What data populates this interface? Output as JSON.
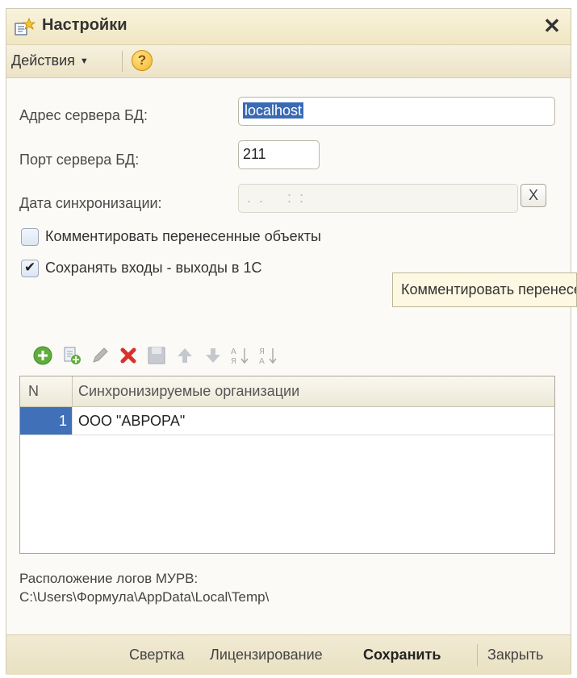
{
  "window": {
    "title": "Настройки"
  },
  "toolbar": {
    "actions_label": "Действия",
    "help_symbol": "?"
  },
  "form": {
    "server_address_label": "Адрес сервера БД:",
    "server_address_value": "localhost",
    "server_port_label": "Порт сервера БД:",
    "server_port_value": "211",
    "sync_date_label": "Дата синхронизации:",
    "sync_date_value": " .  .      :  :",
    "clear_button_label": "X",
    "comment_checkbox_label": "Комментировать перенесенные объекты",
    "comment_checked": false,
    "save_entries_checkbox_label": "Сохранять входы - выходы в 1С",
    "save_entries_checked": true
  },
  "tooltip": {
    "text": "Комментировать перенесенные объекты"
  },
  "table_toolbar": {
    "icons": [
      "add-icon",
      "copy-icon",
      "edit-icon",
      "delete-icon",
      "end-edit-icon",
      "move-up-icon",
      "move-down-icon",
      "sort-asc-icon",
      "sort-desc-icon"
    ]
  },
  "table": {
    "columns": [
      "N",
      "Синхронизируемые организации"
    ],
    "rows": [
      {
        "n": "1",
        "organization": "ООО \"АВРОРА\""
      }
    ]
  },
  "logs": {
    "label": "Расположение логов МУРВ:",
    "path": "C:\\Users\\Формула\\AppData\\Local\\Temp\\"
  },
  "bottom": {
    "fold_label": "Свертка",
    "licensing_label": "Лицензирование",
    "save_label": "Сохранить",
    "close_label": "Закрыть"
  },
  "colors": {
    "selection": "#3a6ab4",
    "title_bg": "#f4ecd0",
    "delete_red": "#d9302b",
    "add_green": "#5fae3c"
  }
}
